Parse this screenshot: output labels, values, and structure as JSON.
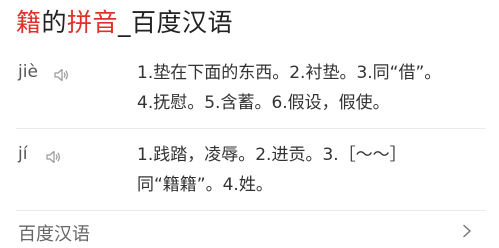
{
  "header": {
    "char": "籍",
    "mid": "的",
    "highlight": "拼音",
    "sep": "_",
    "source": "百度汉语"
  },
  "entries": [
    {
      "pinyin": "jiè",
      "speaker_icon": "speaker-icon",
      "lines": [
        "1.垫在下面的东西。2.衬垫。3.同“借”。",
        "4.抚慰。5.含蓄。6.假设，假使。"
      ]
    },
    {
      "pinyin": "jí",
      "speaker_icon": "speaker-icon",
      "lines": [
        "1.践踏，凌辱。2.进贡。3.［～～］",
        "同“籍籍”。4.姓。"
      ]
    }
  ],
  "footer": {
    "label": "百度汉语",
    "chevron_icon": "chevron-right-icon"
  },
  "colors": {
    "highlight": "#e0302a",
    "text": "#333333",
    "muted": "#666666"
  }
}
